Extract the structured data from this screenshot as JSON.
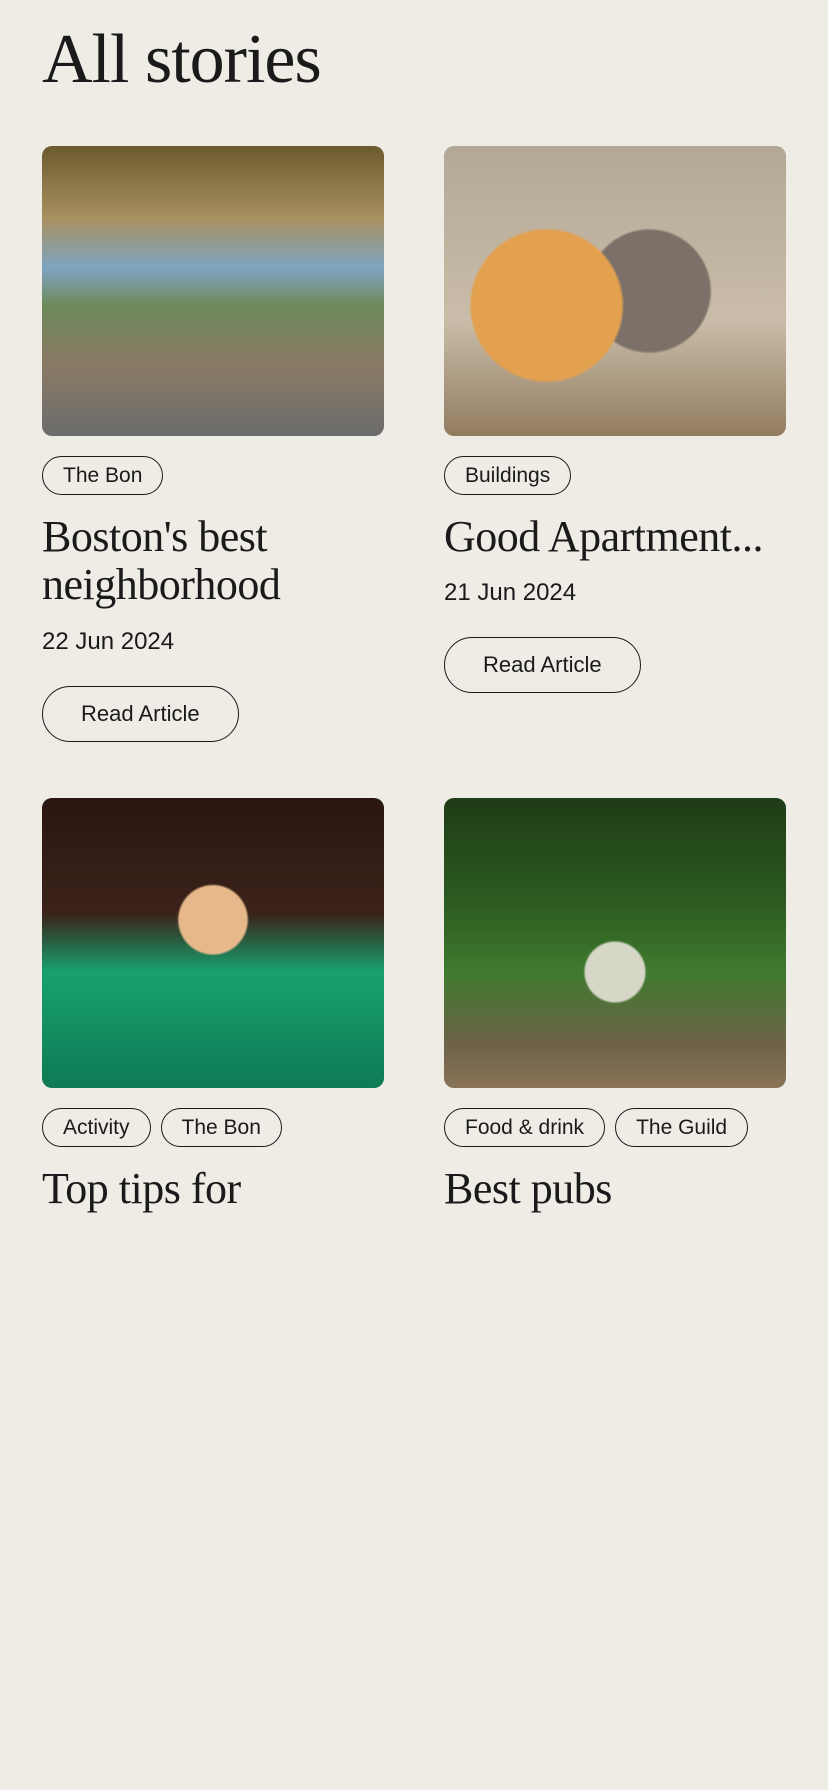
{
  "heading": "All stories",
  "read_label": "Read Article",
  "cards": [
    {
      "thumb_class": "scene-tram",
      "tags": [
        "The Bon"
      ],
      "title": "Boston's best neighborhood",
      "date": "22 Jun 2024",
      "show_read": true
    },
    {
      "thumb_class": "scene-cats",
      "tags": [
        "Buildings"
      ],
      "title": "Good Apartment...",
      "date": "21 Jun 2024",
      "show_read": true
    },
    {
      "thumb_class": "scene-fan",
      "tags": [
        "Activity",
        "The Bon"
      ],
      "title": "Top tips for",
      "date": "",
      "show_read": false
    },
    {
      "thumb_class": "scene-garden",
      "tags": [
        "Food & drink",
        "The Guild"
      ],
      "title": "Best pubs",
      "date": "",
      "show_read": false
    }
  ]
}
